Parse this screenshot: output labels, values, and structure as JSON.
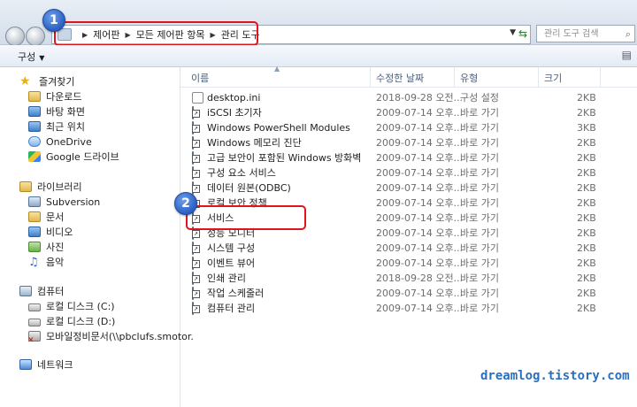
{
  "window": {
    "breadcrumb": [
      "제어판",
      "모든 제어판 항목",
      "관리 도구"
    ],
    "search_placeholder": "관리 도구 검색",
    "organize_label": "구성"
  },
  "badges": [
    "1",
    "2"
  ],
  "sidebar": {
    "favorites": {
      "label": "즐겨찾기",
      "items": [
        {
          "label": "다운로드",
          "icon": "downloads-icon"
        },
        {
          "label": "바탕 화면",
          "icon": "desktop-icon"
        },
        {
          "label": "최근 위치",
          "icon": "recent-places-icon"
        },
        {
          "label": "OneDrive",
          "icon": "onedrive-icon"
        },
        {
          "label": "Google 드라이브",
          "icon": "google-drive-icon"
        }
      ]
    },
    "libraries": {
      "label": "라이브러리",
      "items": [
        {
          "label": "Subversion",
          "icon": "subversion-icon"
        },
        {
          "label": "문서",
          "icon": "documents-icon"
        },
        {
          "label": "비디오",
          "icon": "videos-icon"
        },
        {
          "label": "사진",
          "icon": "pictures-icon"
        },
        {
          "label": "음악",
          "icon": "music-icon"
        }
      ]
    },
    "computer": {
      "label": "컴퓨터",
      "items": [
        {
          "label": "로컬 디스크 (C:)",
          "icon": "drive-icon"
        },
        {
          "label": "로컬 디스크 (D:)",
          "icon": "drive-icon"
        },
        {
          "label": "모바일정비문서(\\\\pbclufs.smotor.",
          "icon": "disconnected-network-drive-icon"
        }
      ]
    },
    "network": {
      "label": "네트워크"
    }
  },
  "columns": {
    "name": "이름",
    "modified": "수정한 날짜",
    "type": "유형",
    "size": "크기"
  },
  "files": [
    {
      "name": "desktop.ini",
      "modified": "2018-09-28 오전...",
      "type": "구성 설정",
      "size": "2KB",
      "kind": "doc"
    },
    {
      "name": "iSCSI 초기자",
      "modified": "2009-07-14 오후...",
      "type": "바로 가기",
      "size": "2KB",
      "kind": "shortcut"
    },
    {
      "name": "Windows PowerShell Modules",
      "modified": "2009-07-14 오후...",
      "type": "바로 가기",
      "size": "3KB",
      "kind": "shortcut"
    },
    {
      "name": "Windows 메모리 진단",
      "modified": "2009-07-14 오후...",
      "type": "바로 가기",
      "size": "2KB",
      "kind": "shortcut"
    },
    {
      "name": "고급 보안이 포함된 Windows 방화벽",
      "modified": "2009-07-14 오후...",
      "type": "바로 가기",
      "size": "2KB",
      "kind": "shortcut"
    },
    {
      "name": "구성 요소 서비스",
      "modified": "2009-07-14 오후...",
      "type": "바로 가기",
      "size": "2KB",
      "kind": "shortcut"
    },
    {
      "name": "데이터 원본(ODBC)",
      "modified": "2009-07-14 오후...",
      "type": "바로 가기",
      "size": "2KB",
      "kind": "shortcut"
    },
    {
      "name": "로컬 보안 정책",
      "modified": "2009-07-14 오후...",
      "type": "바로 가기",
      "size": "2KB",
      "kind": "shortcut"
    },
    {
      "name": "서비스",
      "modified": "2009-07-14 오후...",
      "type": "바로 가기",
      "size": "2KB",
      "kind": "shortcut"
    },
    {
      "name": "성능 모니터",
      "modified": "2009-07-14 오후...",
      "type": "바로 가기",
      "size": "2KB",
      "kind": "shortcut"
    },
    {
      "name": "시스템 구성",
      "modified": "2009-07-14 오후...",
      "type": "바로 가기",
      "size": "2KB",
      "kind": "shortcut"
    },
    {
      "name": "이벤트 뷰어",
      "modified": "2009-07-14 오후...",
      "type": "바로 가기",
      "size": "2KB",
      "kind": "shortcut"
    },
    {
      "name": "인쇄 관리",
      "modified": "2018-09-28 오전...",
      "type": "바로 가기",
      "size": "2KB",
      "kind": "shortcut"
    },
    {
      "name": "작업 스케줄러",
      "modified": "2009-07-14 오후...",
      "type": "바로 가기",
      "size": "2KB",
      "kind": "shortcut"
    },
    {
      "name": "컴퓨터 관리",
      "modified": "2009-07-14 오후...",
      "type": "바로 가기",
      "size": "2KB",
      "kind": "shortcut"
    }
  ],
  "watermark": "dreamlog.tistory.com"
}
